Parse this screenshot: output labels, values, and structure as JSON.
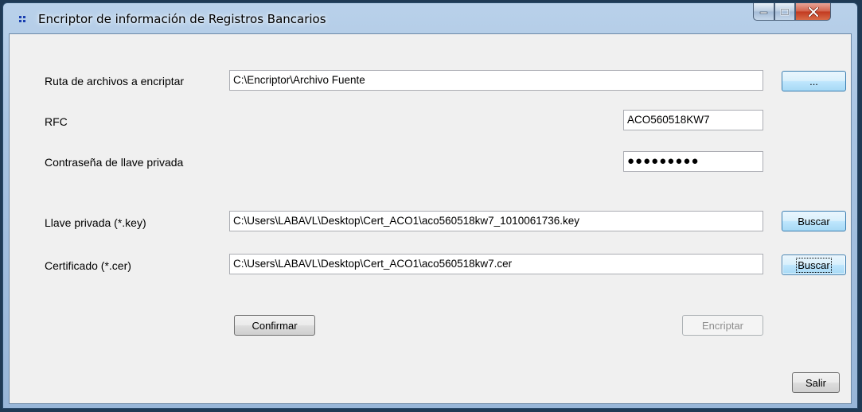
{
  "window": {
    "title": "Encriptor de información de Registros Bancarios",
    "controls": {
      "minimize": "minimize",
      "maximize": "maximize",
      "close": "close"
    }
  },
  "form": {
    "source_path": {
      "label": "Ruta de archivos a encriptar",
      "value": "C:\\Encriptor\\Archivo Fuente",
      "browse_label": "..."
    },
    "rfc": {
      "label": "RFC",
      "value": "ACO560518KW7"
    },
    "password": {
      "label": "Contraseña de llave privada",
      "value": "●●●●●●●●●"
    },
    "private_key": {
      "label": "Llave privada (*.key)",
      "value": "C:\\Users\\LABAVL\\Desktop\\Cert_ACO1\\aco560518kw7_1010061736.key",
      "button_label": "Buscar"
    },
    "certificate": {
      "label": "Certificado (*.cer)",
      "value": "C:\\Users\\LABAVL\\Desktop\\Cert_ACO1\\aco560518kw7.cer",
      "button_label": "Buscar"
    }
  },
  "actions": {
    "confirm_label": "Confirmar",
    "encrypt_label": "Encriptar",
    "exit_label": "Salir"
  }
}
